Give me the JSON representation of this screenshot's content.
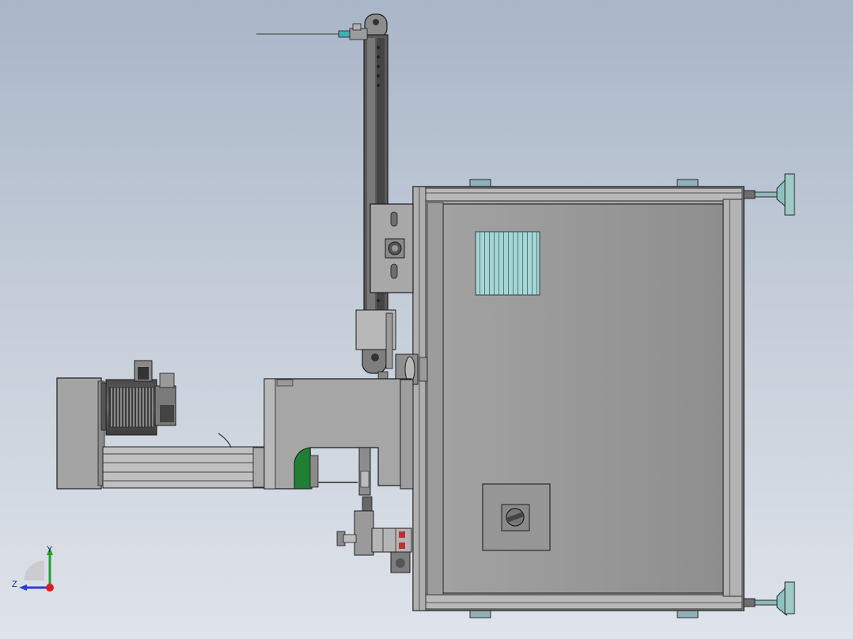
{
  "view": {
    "name": "cad-side-view",
    "background_top": "#a9b6c8",
    "background_bottom": "#dfe3ea"
  },
  "triad": {
    "y_label": "Y",
    "z_label": "Z",
    "y_color": "#1fa02a",
    "z_color": "#2a3fd8",
    "origin_color": "#d81e1e"
  },
  "colors": {
    "metal": "#9a9a9a",
    "metal_dark": "#5c5c5c",
    "metal_light": "#c4c4c4",
    "outline": "#2b2b2b",
    "vent": "#9ecfd0",
    "teal": "#6fb7b0",
    "green": "#1f8a3a",
    "red": "#c03030"
  }
}
